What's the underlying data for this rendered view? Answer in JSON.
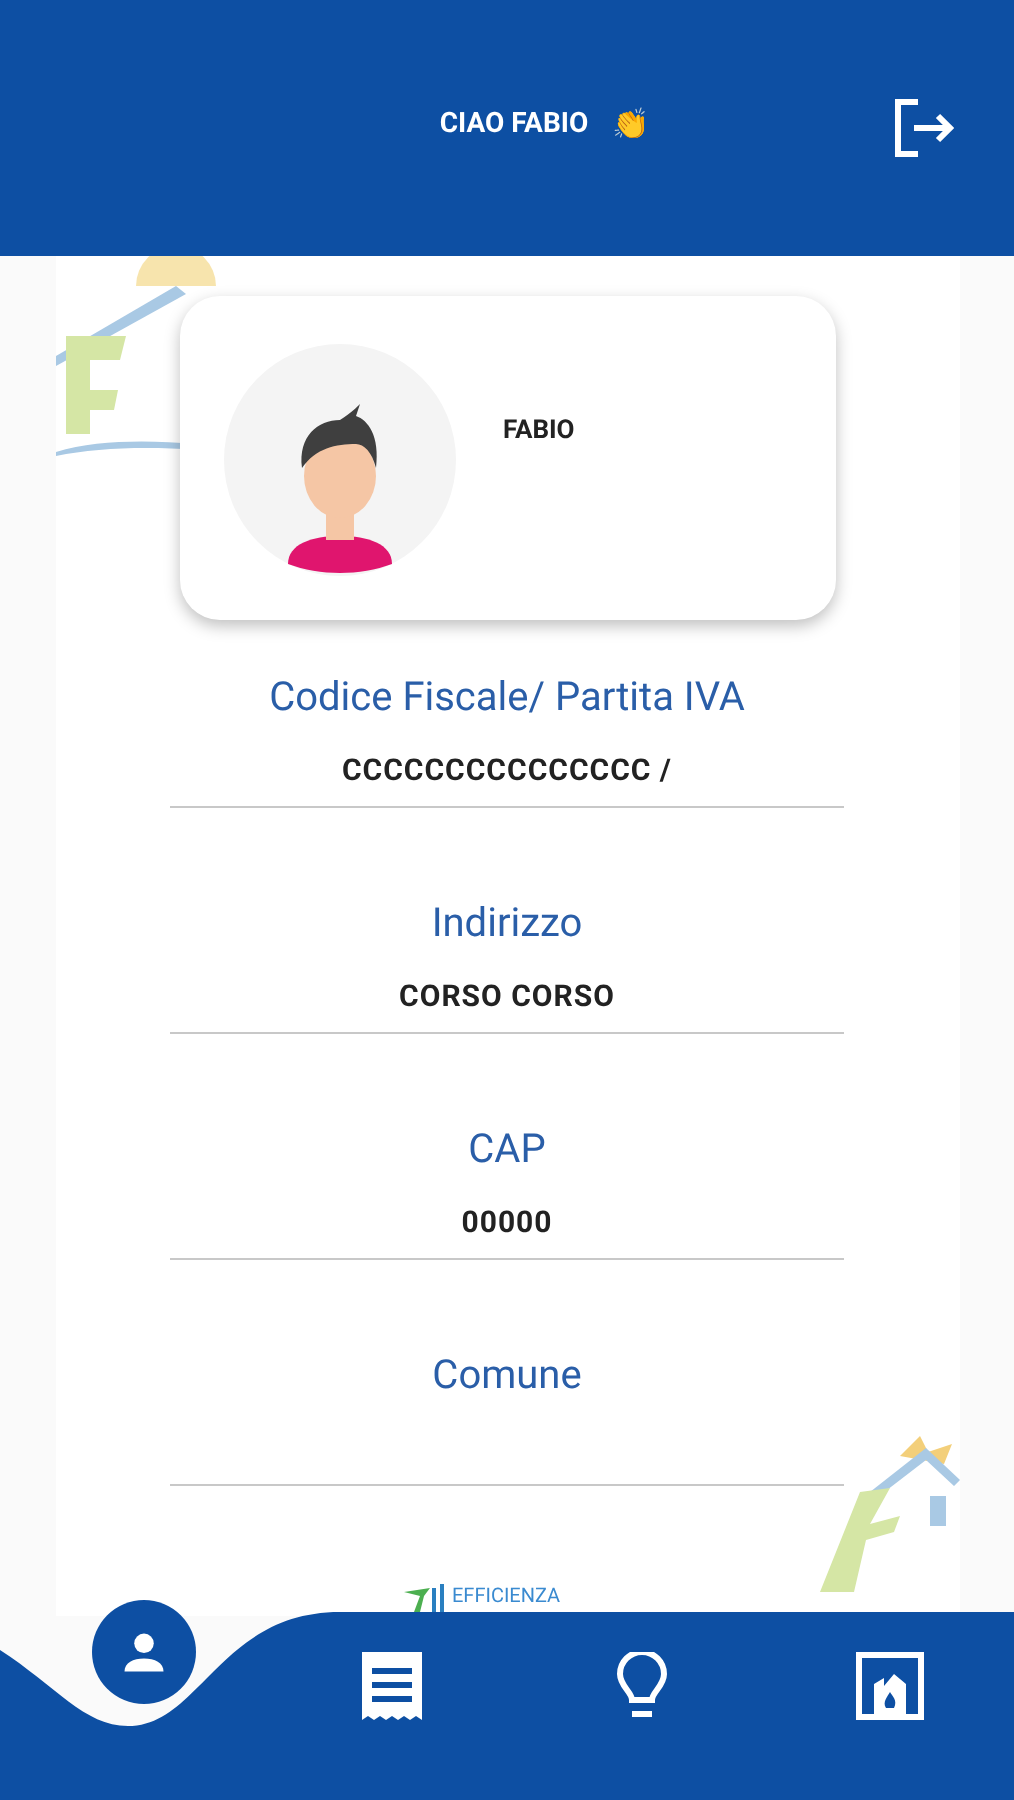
{
  "header": {
    "greeting": "CIAO FABIO",
    "emoji": "👏"
  },
  "profile": {
    "name": "FABIO"
  },
  "fields": [
    {
      "label": "Codice Fiscale/ Partita IVA",
      "value": "CCCCCCCCCCCCCCC /"
    },
    {
      "label": "Indirizzo",
      "value": "CORSO CORSO"
    },
    {
      "label": "CAP",
      "value": "00000"
    },
    {
      "label": "Comune"
    }
  ],
  "logo": {
    "text": "EFFICIENZA"
  },
  "nav": [
    {
      "kind": "profile",
      "selected": true
    },
    {
      "kind": "receipt",
      "selected": false
    },
    {
      "kind": "bulb",
      "selected": false
    },
    {
      "kind": "fireplace",
      "selected": false
    }
  ]
}
